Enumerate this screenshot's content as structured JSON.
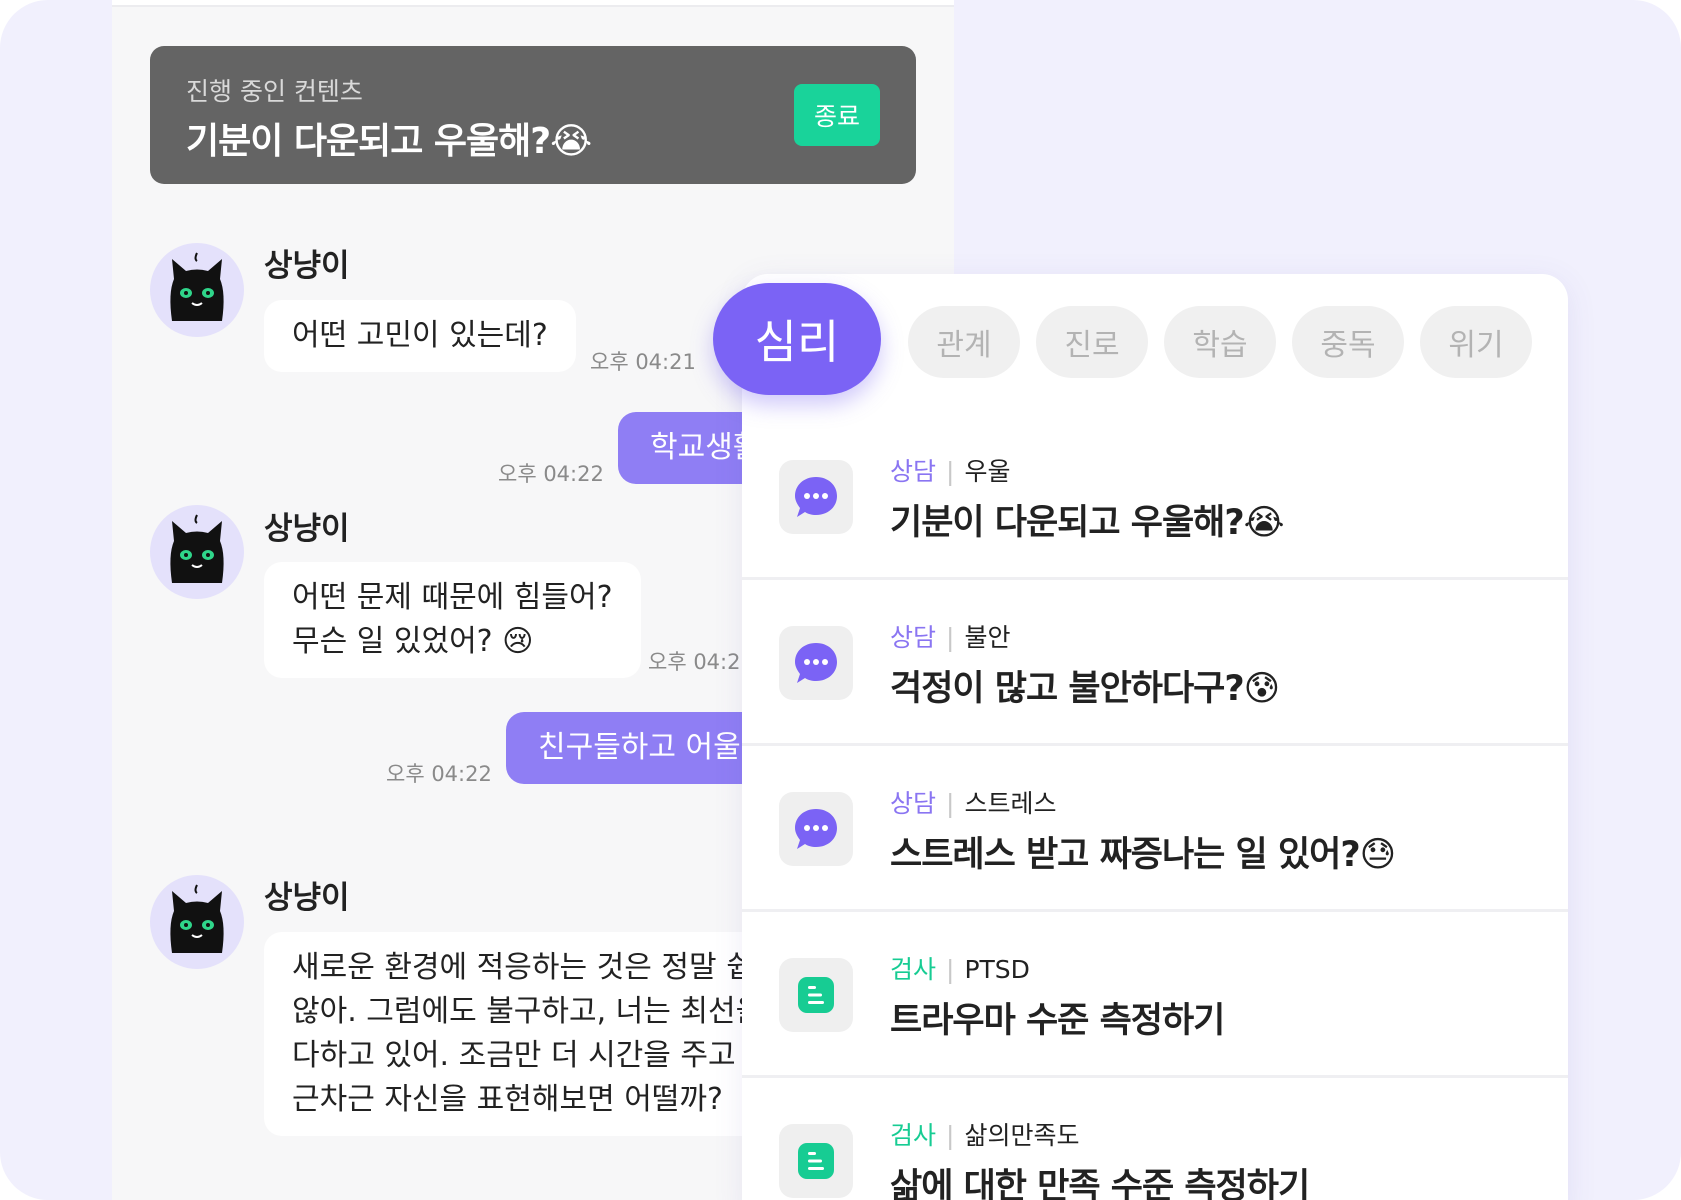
{
  "ongoing": {
    "label": "진행 중인 컨텐츠",
    "title": "기분이 다운되고 우울해?😭",
    "end_button": "종료"
  },
  "chat": {
    "sender": "상냥이",
    "messages": [
      {
        "text": "어떤 고민이 있는데?",
        "time": "오후 04:21"
      },
      {
        "text": "학교생활",
        "time": "오후 04:22"
      },
      {
        "text": "어떤 문제 때문에 힘들어?\n무슨 일 있었어? 😢",
        "time": "오후 04:2"
      },
      {
        "text": "친구들하고 어울리",
        "time": "오후 04:22"
      },
      {
        "text": "새로운 환경에 적응하는 것은 정말 쉽\n않아. 그럼에도 불구하고, 너는 최선을\n다하고 있어. 조금만 더 시간을 주고 차\n근차근 자신을 표현해보면 어떨까?"
      }
    ]
  },
  "categories": {
    "active": "심리",
    "tabs": [
      "관계",
      "진로",
      "학습",
      "중독",
      "위기"
    ]
  },
  "items": [
    {
      "type": "상담",
      "topic": "우울",
      "title": "기분이 다운되고 우울해?😭",
      "icon": "chat-bubble-icon"
    },
    {
      "type": "상담",
      "topic": "불안",
      "title": "걱정이 많고 불안하다구?😰",
      "icon": "chat-bubble-icon"
    },
    {
      "type": "상담",
      "topic": "스트레스",
      "title": "스트레스 받고 짜증나는 일 있어?😓",
      "icon": "chat-bubble-icon"
    },
    {
      "type": "검사",
      "topic": "PTSD",
      "title": "트라우마 수준 측정하기",
      "icon": "test-sheet-icon"
    },
    {
      "type": "검사",
      "topic": "삶의만족도",
      "title": "삶에 대한 만족 수준 측정하기",
      "icon": "test-sheet-icon"
    }
  ],
  "colors": {
    "accent": "#7b63f5",
    "bubble_out": "#8f7ef4",
    "test_green": "#17cc93",
    "ongoing_bg": "#646464"
  }
}
